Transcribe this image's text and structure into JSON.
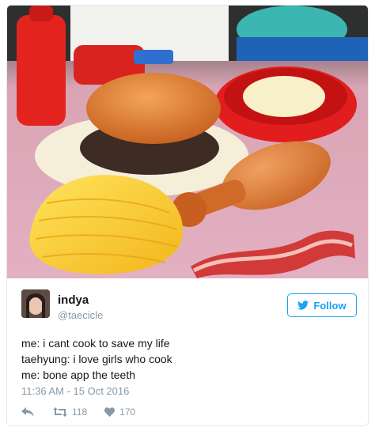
{
  "tweet": {
    "author_name": "indya",
    "author_handle": "@taecicle",
    "follow_label": "Follow",
    "lines": [
      "me: i cant cook to save my life",
      "taehyung: i love girls who cook",
      "me: bone app the teeth"
    ],
    "timestamp": "11:36 AM - 15 Oct 2016",
    "retweets": "118",
    "likes": "170"
  },
  "icons": {
    "follow": "twitter-bird-icon",
    "reply": "reply-icon",
    "retweet": "retweet-icon",
    "like": "heart-icon"
  },
  "colors": {
    "accent": "#1da1f2",
    "muted": "#8899a6",
    "text": "#14171a",
    "border": "#e1e8ed"
  }
}
